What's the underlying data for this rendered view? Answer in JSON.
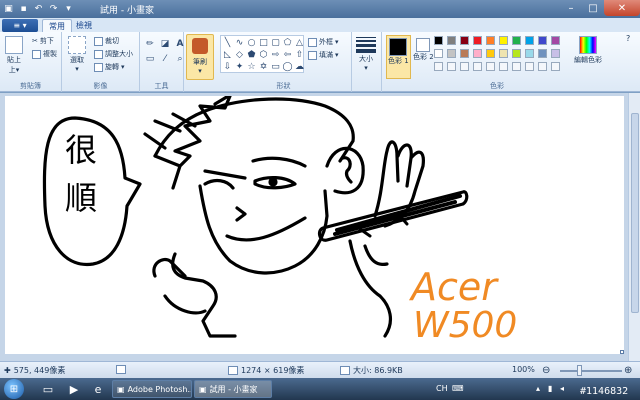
{
  "window": {
    "title": "試用 - 小畫家",
    "qat_icons": [
      "save-icon",
      "undo-icon",
      "redo-icon"
    ]
  },
  "tabs": {
    "app_menu": "≡ ▾",
    "items": [
      "常用",
      "檢視"
    ]
  },
  "ribbon": {
    "clipboard": {
      "paste": "貼上",
      "cut": "剪下",
      "copy": "複製",
      "group": "剪貼簿"
    },
    "image": {
      "select": "選取",
      "crop": "裁切",
      "resize": "調整大小",
      "rotate": "旋轉",
      "group": "影像"
    },
    "tools": {
      "group": "工具"
    },
    "brushes": {
      "label": "筆刷"
    },
    "shapes": {
      "outline": "外框",
      "fill": "填滿",
      "group": "形狀"
    },
    "size": {
      "label": "大小"
    },
    "colors": {
      "color1": "色彩 1",
      "color2": "色彩 2",
      "edit": "編輯色彩",
      "group": "色彩",
      "color1_value": "#000000",
      "color2_value": "#ffffff",
      "palette_row1": [
        "#000000",
        "#7f7f7f",
        "#880015",
        "#ed1c24",
        "#ff7f27",
        "#fff200",
        "#22b14c",
        "#00a2e8",
        "#3f48cc",
        "#a349a4"
      ],
      "palette_row2": [
        "#ffffff",
        "#c3c3c3",
        "#b97a57",
        "#ffaec9",
        "#ffc90e",
        "#efe4b0",
        "#b5e61d",
        "#99d9ea",
        "#7092be",
        "#c8bfe7"
      ]
    }
  },
  "drawing": {
    "bubble_text_1": "很",
    "bubble_text_2": "順",
    "brand_line1": "Acer",
    "brand_line2": "W500",
    "brand_color": "#f08a24"
  },
  "statusbar": {
    "cursor": "575, 449像素",
    "dimensions": "1274 × 619像素",
    "size": "大小: 86.9KB",
    "zoom": "100%"
  },
  "taskbar": {
    "apps": [
      "Adobe Photosh...",
      "試用 - 小畫家"
    ],
    "lang": "CH",
    "watermark": "#1146832"
  }
}
